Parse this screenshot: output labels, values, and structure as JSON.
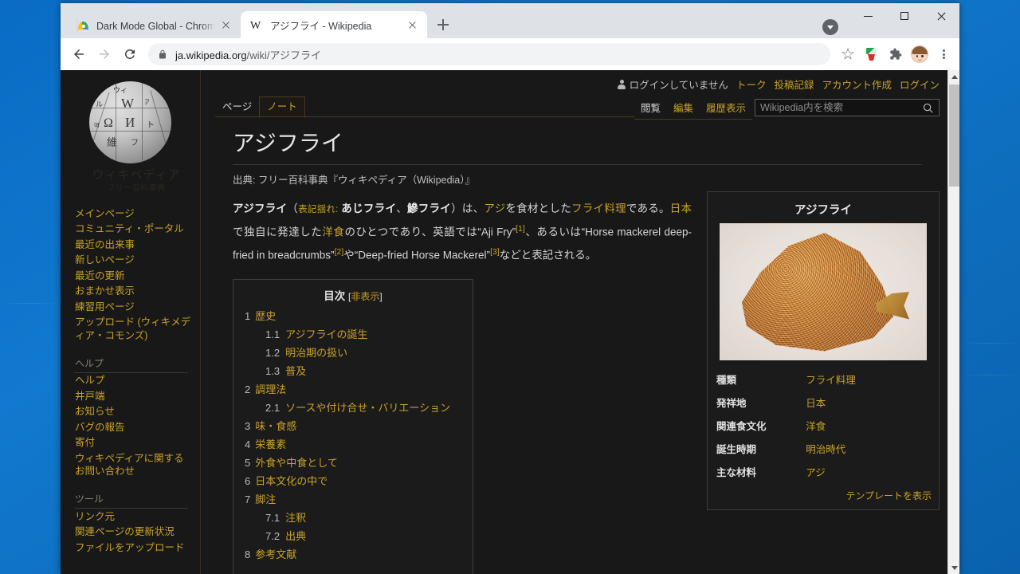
{
  "window": {
    "controls": {
      "minimize": "minimize-button",
      "maximize": "maximize-button",
      "close": "close-button"
    }
  },
  "browser": {
    "tabs": [
      {
        "title": "Dark Mode Global - Chrome ウェ",
        "favicon": "chrome-web-store-icon",
        "active": false
      },
      {
        "title": "アジフライ - Wikipedia",
        "favicon": "wikipedia-w-icon",
        "active": true
      }
    ],
    "new_tab_label": "+",
    "toolbar": {
      "back": "back-arrow-icon",
      "forward": "forward-arrow-icon",
      "reload": "reload-icon",
      "url_host": "ja.wikipedia.org",
      "url_path": "/wiki/アジフライ",
      "lock": "lock-icon",
      "bookmark": "star-icon",
      "extension_dark_mode": "paint-roller-icon",
      "extensions": "puzzle-piece-icon",
      "profile": "avatar-icon",
      "menu": "three-dot-menu-icon"
    }
  },
  "wiki": {
    "logo": {
      "wordmark": "ウィキペディア",
      "tagline": "フリー百科事典"
    },
    "personal_bar": {
      "status": "ログインしていません",
      "links": [
        "トーク",
        "投稿記録",
        "アカウント作成",
        "ログイン"
      ]
    },
    "namespace_tabs": [
      {
        "label": "ページ",
        "selected": true
      },
      {
        "label": "ノート",
        "selected": false
      }
    ],
    "view_tabs": [
      {
        "label": "閲覧",
        "selected": true
      },
      {
        "label": "編集",
        "selected": false
      },
      {
        "label": "履歴表示",
        "selected": false
      }
    ],
    "search": {
      "placeholder": "Wikipedia内を検索",
      "value": "",
      "icon": "search-icon"
    },
    "sidebar": {
      "nav_top": [
        "メインページ",
        "コミュニティ・ポータル",
        "最近の出来事",
        "新しいページ",
        "最近の更新",
        "おまかせ表示",
        "練習用ページ",
        "アップロード (ウィキメディア・コモンズ)"
      ],
      "help_heading": "ヘルプ",
      "help_links": [
        "ヘルプ",
        "井戸端",
        "お知らせ",
        "バグの報告",
        "寄付",
        "ウィキペディアに関するお問い合わせ"
      ],
      "tools_heading": "ツール",
      "tools_links": [
        "リンク元",
        "関連ページの更新状況",
        "ファイルをアップロード"
      ]
    },
    "article": {
      "title": "アジフライ",
      "site_sub": "出典: フリー百科事典『ウィキペディア（Wikipedia）』",
      "lead": {
        "t1": "アジフライ",
        "t2": "（",
        "t3": "表記揺れ:",
        "t4": " ",
        "t5": "あじフライ",
        "t6": "、",
        "t7": "鰺フライ",
        "t8": "）は、",
        "link_aji": "アジ",
        "t9": "を食材とした",
        "link_fry": "フライ料理",
        "t10": "である。",
        "link_japan": "日本",
        "t11": "で独自に発達した",
        "link_yoshoku": "洋食",
        "t12": "のひとつであり、英語では",
        "t13": "“Aji Fry”",
        "ref1": "[1]",
        "t14": "、あるいは",
        "t15": "“Horse mackerel deep-fried in breadcrumbs”",
        "ref2": "[2]",
        "t16": "や",
        "t17": "“Deep-fried Horse Mackerel”",
        "ref3": "[3]",
        "t18": "などと表記される。"
      },
      "toc": {
        "title": "目次",
        "toggle_open": "[",
        "toggle": "非表示",
        "toggle_close": "]",
        "items": [
          {
            "num": "1",
            "label": "歴史",
            "level": 1
          },
          {
            "num": "1.1",
            "label": "アジフライの誕生",
            "level": 2
          },
          {
            "num": "1.2",
            "label": "明治期の扱い",
            "level": 2
          },
          {
            "num": "1.3",
            "label": "普及",
            "level": 2
          },
          {
            "num": "2",
            "label": "調理法",
            "level": 1
          },
          {
            "num": "2.1",
            "label": "ソースや付け合せ・バリエーション",
            "level": 2
          },
          {
            "num": "3",
            "label": "味・食感",
            "level": 1
          },
          {
            "num": "4",
            "label": "栄養素",
            "level": 1
          },
          {
            "num": "5",
            "label": "外食や中食として",
            "level": 1
          },
          {
            "num": "6",
            "label": "日本文化の中で",
            "level": 1
          },
          {
            "num": "7",
            "label": "脚注",
            "level": 1
          },
          {
            "num": "7.1",
            "label": "注釈",
            "level": 2
          },
          {
            "num": "7.2",
            "label": "出典",
            "level": 2
          },
          {
            "num": "8",
            "label": "参考文献",
            "level": 1
          }
        ]
      },
      "infobox": {
        "title": "アジフライ",
        "image_alt": "アジフライの写真",
        "rows": [
          {
            "header": "種類",
            "value": "フライ料理"
          },
          {
            "header": "発祥地",
            "value": "日本"
          },
          {
            "header": "関連食文化",
            "value": "洋食"
          },
          {
            "header": "誕生時期",
            "value": "明治時代"
          },
          {
            "header": "主な材料",
            "value": "アジ"
          }
        ],
        "footer_link": "テンプレートを表示"
      }
    }
  },
  "colors": {
    "page_bg": "#181818",
    "link": "#c9a227",
    "text": "#d5d5d5",
    "desktop": "#0e6fc0"
  }
}
